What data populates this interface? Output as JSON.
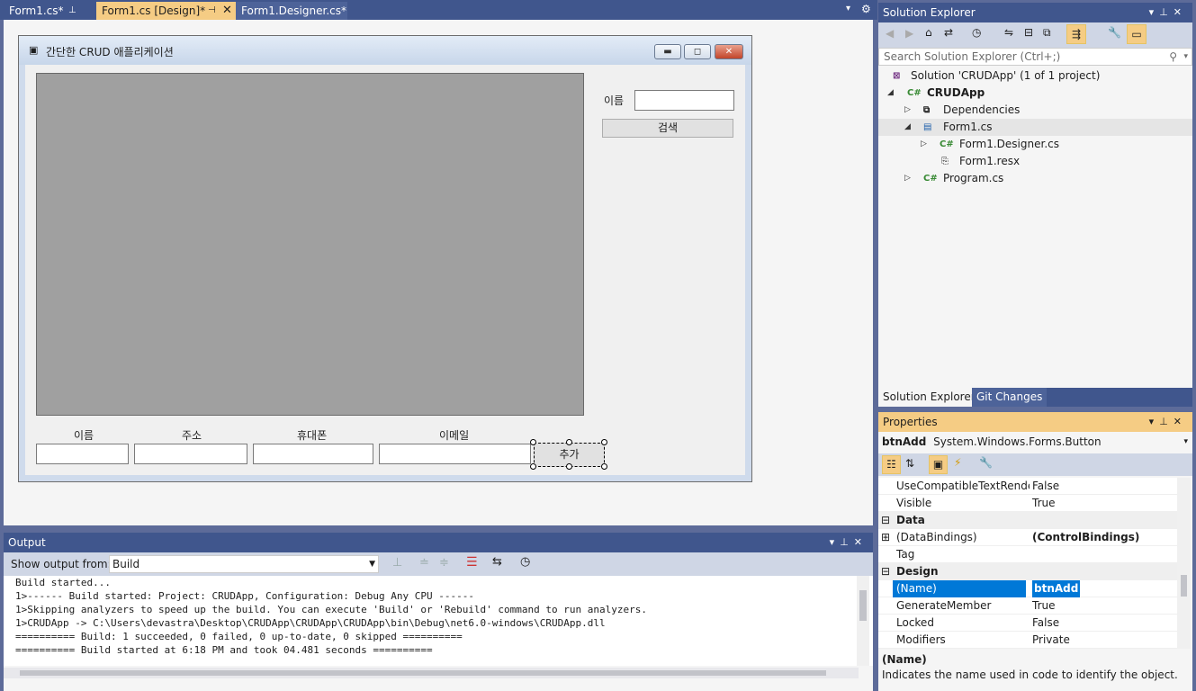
{
  "doc_tabs": [
    {
      "label": "Form1.cs*",
      "pinned": true
    },
    {
      "label": "Form1.cs [Design]*",
      "active": true
    },
    {
      "label": "Form1.Designer.cs*"
    }
  ],
  "form": {
    "title": "간단한 CRUD 애플리케이션",
    "search_label": "이름",
    "search_button": "검색",
    "field_labels": {
      "name": "이름",
      "address": "주소",
      "phone": "휴대폰",
      "email": "이메일"
    },
    "add_button": "추가"
  },
  "output": {
    "title": "Output",
    "show_from_label": "Show output from:",
    "source": "Build",
    "lines": [
      "Build started...",
      "1>------ Build started: Project: CRUDApp, Configuration: Debug Any CPU ------",
      "1>Skipping analyzers to speed up the build. You can execute 'Build' or 'Rebuild' command to run analyzers.",
      "1>CRUDApp -> C:\\Users\\devastra\\Desktop\\CRUDApp\\CRUDApp\\CRUDApp\\bin\\Debug\\net6.0-windows\\CRUDApp.dll",
      "========== Build: 1 succeeded, 0 failed, 0 up-to-date, 0 skipped ==========",
      "========== Build started at 6:18 PM and took 04.481 seconds =========="
    ]
  },
  "solution_explorer": {
    "title": "Solution Explorer",
    "search_placeholder": "Search Solution Explorer (Ctrl+;)",
    "tree": [
      {
        "label": "Solution 'CRUDApp'  (1 of 1 project)",
        "icon": "solution-icon"
      },
      {
        "label": "CRUDApp",
        "icon": "csharp-project-icon",
        "bold": true
      },
      {
        "label": "Dependencies",
        "icon": "dependencies-icon"
      },
      {
        "label": "Form1.cs",
        "icon": "form-icon",
        "selected": true
      },
      {
        "label": "Form1.Designer.cs",
        "icon": "csharp-file-icon"
      },
      {
        "label": "Form1.resx",
        "icon": "resx-file-icon"
      },
      {
        "label": "Program.cs",
        "icon": "csharp-file-icon"
      }
    ],
    "tabs": [
      "Solution Explorer",
      "Git Changes"
    ]
  },
  "properties": {
    "title": "Properties",
    "object_name": "btnAdd",
    "object_type": "System.Windows.Forms.Button",
    "rows": [
      {
        "name": "UseCompatibleTextRenderir",
        "value": "False"
      },
      {
        "name": "Visible",
        "value": "True"
      },
      {
        "name": "Data",
        "category": true
      },
      {
        "name": "(DataBindings)",
        "value": "(ControlBindings)",
        "expandable": true
      },
      {
        "name": "Tag",
        "value": ""
      },
      {
        "name": "Design",
        "category": true
      },
      {
        "name": "(Name)",
        "value": "btnAdd",
        "selected": true
      },
      {
        "name": "GenerateMember",
        "value": "True"
      },
      {
        "name": "Locked",
        "value": "False"
      },
      {
        "name": "Modifiers",
        "value": "Private"
      }
    ],
    "desc_title": "(Name)",
    "desc_text": "Indicates the name used in code to identify the object."
  }
}
